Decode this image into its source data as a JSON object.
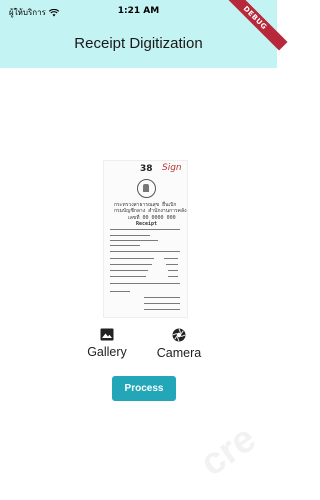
{
  "status_bar": {
    "carrier": "ผู้ให้บริการ",
    "time": "1:21 AM"
  },
  "app_bar": {
    "title": "Receipt Digitization",
    "debug_label": "DEBUG",
    "color": "#c4f3f3"
  },
  "receipt": {
    "number": "38",
    "lines": [
      "กระทรวงสาธารณสุข ยื่นเบิก",
      "กรมบัญชีกลาง สำนักงานการคลัง",
      "เลขที่ 00 0000 000",
      "Receipt"
    ]
  },
  "actions": {
    "gallery": {
      "label": "Gallery",
      "icon": "image-icon"
    },
    "camera": {
      "label": "Camera",
      "icon": "camera-shutter-icon"
    }
  },
  "process_button": {
    "label": "Process",
    "color": "#23a7b8"
  }
}
